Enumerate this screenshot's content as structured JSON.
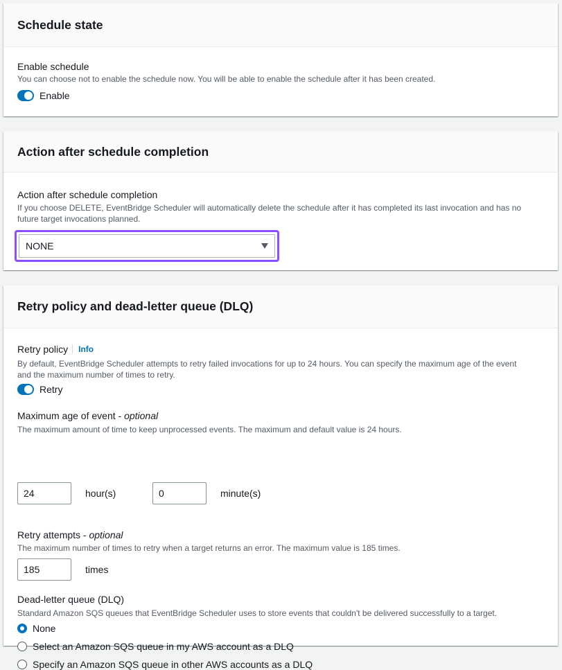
{
  "schedule_state": {
    "title": "Schedule state",
    "enable_label": "Enable schedule",
    "enable_desc": "You can choose not to enable the schedule now. You will be able to enable the schedule after it has been created.",
    "toggle_label": "Enable",
    "toggle_on": true
  },
  "completion": {
    "title": "Action after schedule completion",
    "label": "Action after schedule completion",
    "desc_line1": "If you choose DELETE, EventBridge Scheduler will automatically delete the schedule after it has completed its last invocation and has no",
    "desc_line2": "future target invocations planned.",
    "selected": "NONE"
  },
  "retry": {
    "title": "Retry policy and dead-letter queue (DLQ)",
    "policy_label": "Retry policy",
    "info_link": "Info",
    "policy_desc_line1": "By default, EventBridge Scheduler attempts to retry failed invocations for up to 24 hours. You can specify the maximum age of the event",
    "policy_desc_line2": "and the maximum number of times to retry.",
    "toggle_label": "Retry",
    "toggle_on": true,
    "max_age_label": "Maximum age of event - ",
    "max_age_optional": "optional",
    "max_age_desc": "The maximum amount of time to keep unprocessed events. The maximum and default value is 24 hours.",
    "hours_value": "24",
    "hours_unit": "hour(s)",
    "minutes_value": "0",
    "minutes_unit": "minute(s)",
    "attempts_label": "Retry attempts - ",
    "attempts_optional": "optional",
    "attempts_desc": "The maximum number of times to retry when a target returns an error. The maximum value is 185 times.",
    "attempts_value": "185",
    "attempts_unit": "times",
    "dlq_label": "Dead-letter queue (DLQ)",
    "dlq_desc": "Standard Amazon SQS queues that EventBridge Scheduler uses to store events that couldn't be delivered successfully to a target.",
    "dlq_options": [
      "None",
      "Select an Amazon SQS queue in my AWS account as a DLQ",
      "Specify an Amazon SQS queue in other AWS accounts as a DLQ"
    ],
    "dlq_selected": "None"
  },
  "colors": {
    "accent": "#0073bb",
    "focus_outline": "#8c4fff",
    "page_bg": "#f2f3f3"
  }
}
